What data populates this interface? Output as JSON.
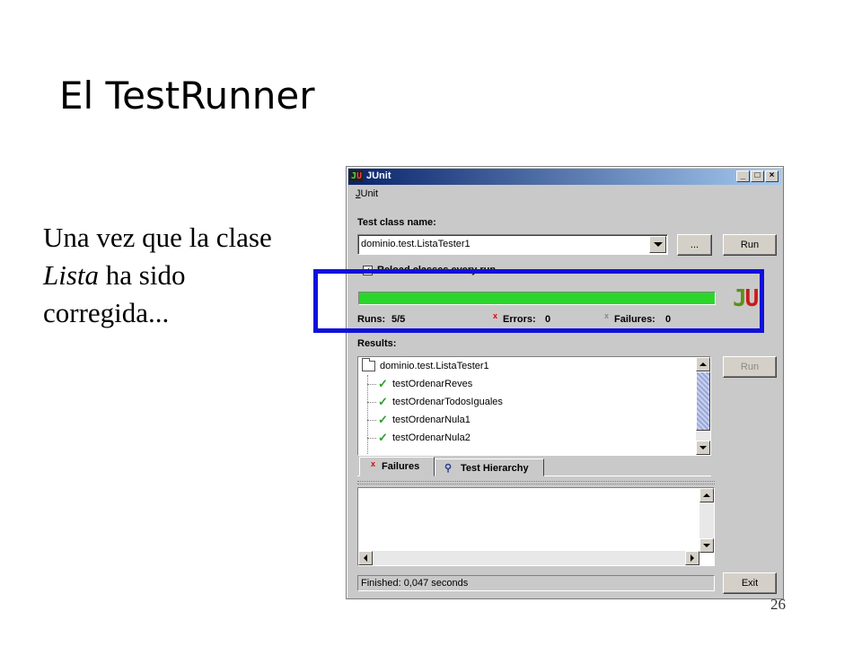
{
  "slide": {
    "title": "El TestRunner",
    "caption_line1": "Una vez que la clase",
    "caption_italic": "Lista",
    "caption_line2_rest": " ha sido",
    "caption_line3": "corregida...",
    "page_number": "26"
  },
  "window": {
    "title": "JUnit",
    "logo_j": "J",
    "logo_u": "U",
    "minimize": "_",
    "maximize": "□",
    "close": "×"
  },
  "menu": {
    "junit": "JUnit"
  },
  "form": {
    "test_class_label": "Test class name:",
    "test_class_value": "dominio.test.ListaTester1",
    "browse_label": "...",
    "run_label": "Run",
    "reload_label": "Reload classes every run",
    "reload_checked": true
  },
  "progress": {
    "fraction": 1.0,
    "color": "#2bd62b"
  },
  "counters": {
    "runs_label": "Runs:",
    "runs_value": "5/5",
    "errors_label": "Errors:",
    "errors_value": "0",
    "failures_label": "Failures:",
    "failures_value": "0"
  },
  "results": {
    "label": "Results:",
    "root": "dominio.test.ListaTester1",
    "tests": [
      "testOrdenarReves",
      "testOrdenarTodosIguales",
      "testOrdenarNula1",
      "testOrdenarNula2"
    ],
    "run_again_label": "Run"
  },
  "tabs": {
    "failures": "Failures",
    "hierarchy": "Test Hierarchy"
  },
  "status": {
    "text": "Finished: 0,047 seconds",
    "exit_label": "Exit"
  },
  "colors": {
    "highlight": "#1010dd",
    "titlebar": "#08246b"
  }
}
